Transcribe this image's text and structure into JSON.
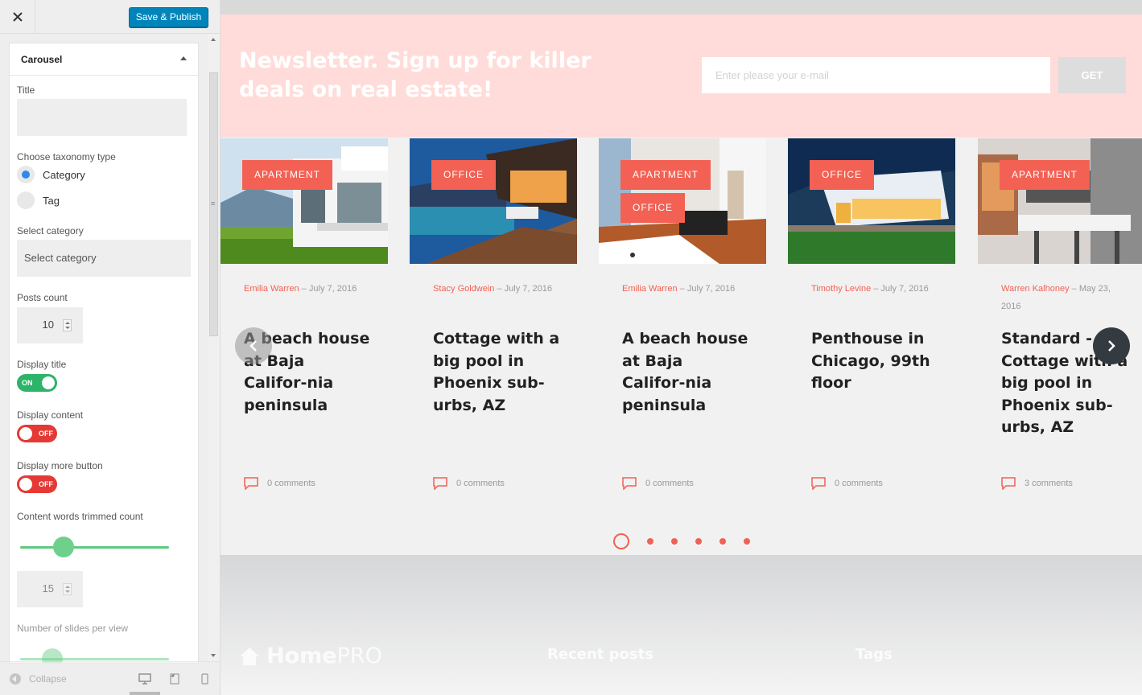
{
  "sidebar": {
    "publish_label": "Save & Publish",
    "section_title": "Carousel",
    "title_label": "Title",
    "taxonomy_label": "Choose taxonomy type",
    "taxonomy_options": [
      {
        "label": "Category",
        "checked": true
      },
      {
        "label": "Tag",
        "checked": false
      }
    ],
    "category_label": "Select category",
    "category_placeholder": "Select category",
    "posts_count_label": "Posts count",
    "posts_count_value": "10",
    "display_title_label": "Display title",
    "display_title_state": "ON",
    "display_content_label": "Display content",
    "display_content_state": "OFF",
    "display_more_label": "Display more button",
    "display_more_state": "OFF",
    "trimmed_label": "Content words trimmed count",
    "trimmed_slider_fraction": 0.29,
    "trimmed_value": "15",
    "slides_label": "Number of slides per view",
    "collapse_label": "Collapse"
  },
  "preview": {
    "newsletter": {
      "heading": "Newsletter. Sign up for killer deals on real estate!",
      "email_placeholder": "Enter please your e-mail",
      "button": "GET"
    },
    "cards": [
      {
        "tags": [
          "APARTMENT"
        ],
        "author": "Emilia Warren",
        "date": "July 7, 2016",
        "title": "A beach house at Baja Califor-nia peninsula",
        "comments": "0 comments"
      },
      {
        "tags": [
          "OFFICE"
        ],
        "author": "Stacy Goldwein",
        "date": "July 7, 2016",
        "title": "Cottage with a big pool in Phoenix sub-urbs, AZ",
        "comments": "0 comments"
      },
      {
        "tags": [
          "APARTMENT",
          "OFFICE"
        ],
        "author": "Emilia Warren",
        "date": "July 7, 2016",
        "title": "A beach house at Baja Califor-nia peninsula",
        "comments": "0 comments"
      },
      {
        "tags": [
          "OFFICE"
        ],
        "author": "Timothy Levine",
        "date": "July 7, 2016",
        "title": "Penthouse in Chicago, 99th floor",
        "comments": "0 comments"
      },
      {
        "tags": [
          "APARTMENT"
        ],
        "author": "Warren Kalhoney",
        "date": "May 23, 2016",
        "title": "Standard - Cottage with a big pool in Phoenix sub-urbs, AZ",
        "comments": "3 comments"
      }
    ],
    "pagination": {
      "count": 6,
      "active": 0
    },
    "footer": {
      "logo_home": "Home",
      "logo_pro": "PRO",
      "recent_posts": "Recent posts",
      "tags": "Tags"
    }
  },
  "colors": {
    "accent": "#f26153",
    "newsletter_bg": "#ffdcd9",
    "publish_blue": "#0085ba",
    "toggle_on": "#2db36a",
    "toggle_off": "#e53935"
  }
}
